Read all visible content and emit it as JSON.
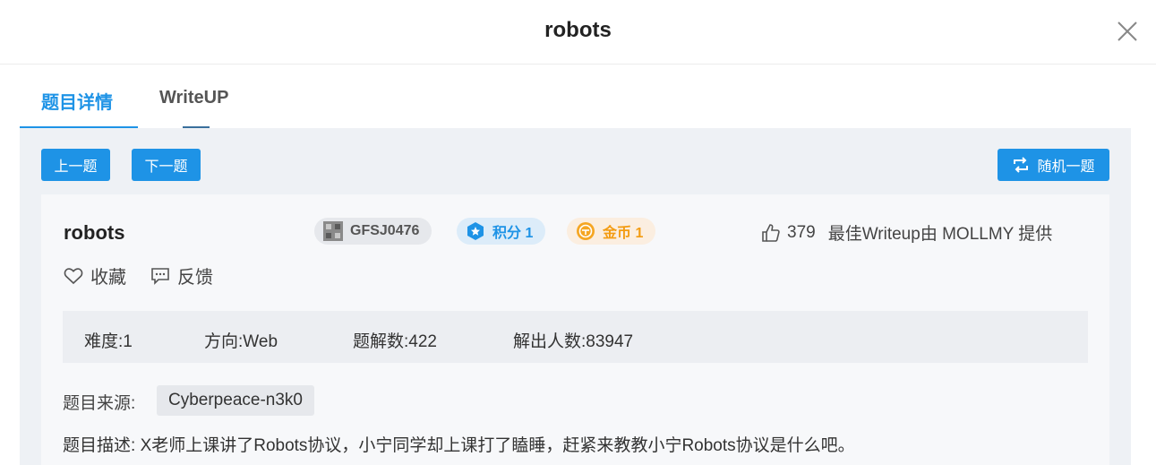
{
  "header": {
    "title": "robots",
    "close_icon": "close-icon"
  },
  "tabs": [
    {
      "label": "题目详情",
      "active": true
    },
    {
      "label": "WriteUP",
      "active": false
    }
  ],
  "toolbar": {
    "prev_label": "上一题",
    "next_label": "下一题",
    "random_label": "随机一题",
    "random_icon": "shuffle-icon"
  },
  "challenge": {
    "name": "robots",
    "badges": {
      "id": "GFSJ0476",
      "score": "积分 1",
      "coins": "金币 1"
    },
    "likes": "379",
    "best_writeup": "最佳Writeup由 MOLLMY 提供",
    "actions": {
      "favorite_label": "收藏",
      "feedback_label": "反馈"
    },
    "stats": {
      "difficulty_label": "难度:",
      "difficulty": "1",
      "direction_label": "方向:",
      "direction": "Web",
      "solutions_label": "题解数:",
      "solutions": "422",
      "solvers_label": "解出人数:",
      "solvers": "83947"
    },
    "source_label": "题目来源:",
    "source": "Cyberpeace-n3k0",
    "description_label": "题目描述:",
    "description": "X老师上课讲了Robots协议，小宁同学却上课打了瞌睡，赶紧来教教小宁Robots协议是什么吧。"
  },
  "colors": {
    "accent": "#1e93e6",
    "score_badge_bg": "#dcecf9",
    "coin_badge_bg": "#fbeee0",
    "id_badge_bg": "#e6e8ec"
  }
}
